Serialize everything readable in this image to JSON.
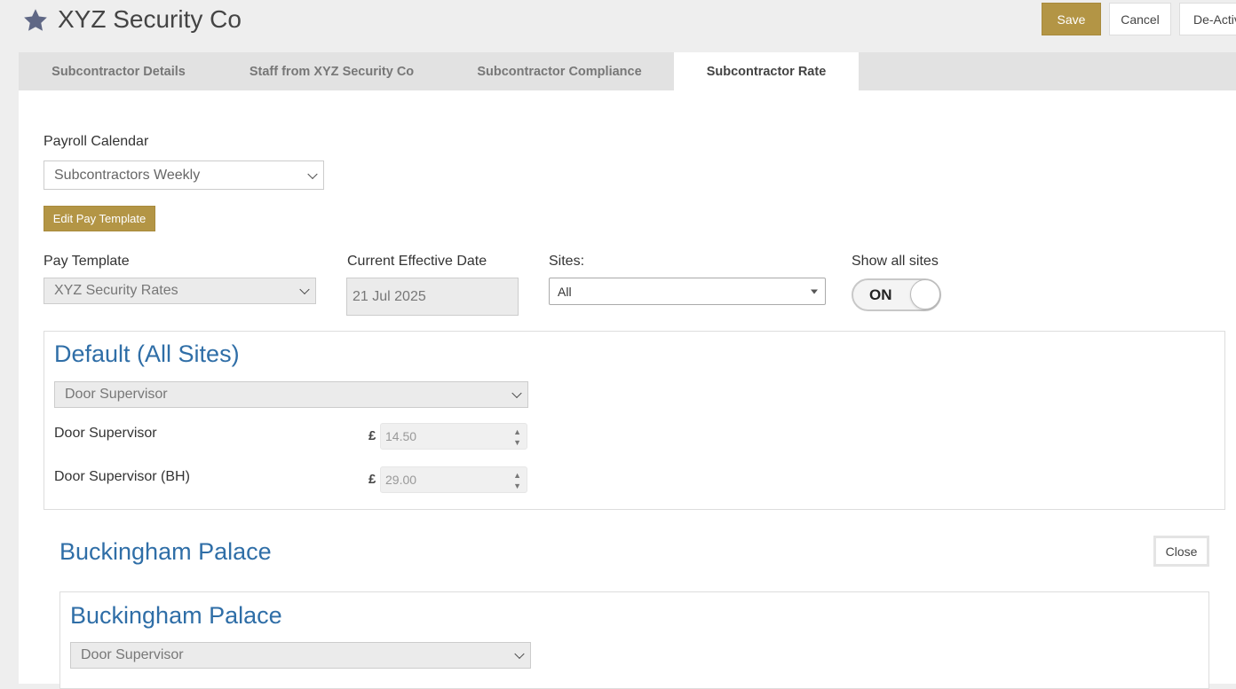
{
  "header": {
    "title": "XYZ Security Co",
    "actions": {
      "save": "Save",
      "cancel": "Cancel",
      "deactivate": "De-Activ"
    }
  },
  "tabs": [
    {
      "label": "Subcontractor Details",
      "active": false
    },
    {
      "label": "Staff from XYZ Security Co",
      "active": false
    },
    {
      "label": "Subcontractor Compliance",
      "active": false
    },
    {
      "label": "Subcontractor Rate",
      "active": true
    }
  ],
  "payroll": {
    "label": "Payroll Calendar",
    "value": "Subcontractors Weekly",
    "edit_button": "Edit Pay Template"
  },
  "filters": {
    "pay_template_label": "Pay Template",
    "pay_template_value": "XYZ Security Rates",
    "effective_date_label": "Current Effective Date",
    "effective_date_value": "21 Jul 2025",
    "sites_label": "Sites:",
    "sites_value": "All",
    "show_all_label": "Show all sites",
    "show_all_state": "ON"
  },
  "default_section": {
    "title": "Default (All Sites)",
    "role_select": "Door Supervisor",
    "currency": "£",
    "rates": [
      {
        "label": "Door Supervisor",
        "value": "14.50"
      },
      {
        "label": "Door Supervisor (BH)",
        "value": "29.00"
      }
    ]
  },
  "site_section": {
    "title": "Buckingham Palace",
    "close": "Close",
    "inner_title": "Buckingham Palace",
    "role_select": "Door Supervisor"
  },
  "icons": {
    "star": "star-icon",
    "spinner": "spinner-arrows-icon",
    "chevron": "chevron-down-icon"
  },
  "colors": {
    "accent": "#b39545",
    "title_blue": "#2f6ea7"
  }
}
